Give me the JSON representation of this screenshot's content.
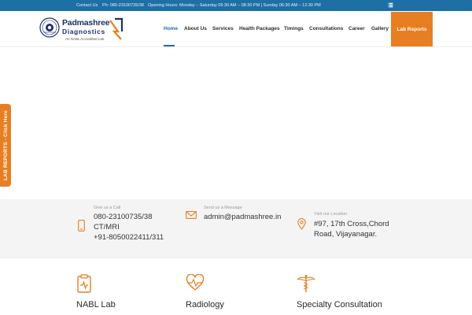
{
  "topbar": {
    "contact_label": "Contact Us",
    "phone": "Ph: 080-23100735/38",
    "hours": "Opening Hours: Monday – Saturday 06:30 AM – 08:30 PM | Sunday 06:30 AM – 12:30 PM"
  },
  "logo": {
    "brand_line1": "Padmashree",
    "brand_line2": "Diagnostics",
    "tagline": "An NABL Accredited Lab"
  },
  "nav": {
    "items": [
      {
        "label": "Home"
      },
      {
        "label": "About Us"
      },
      {
        "label": "Services"
      },
      {
        "label": "Health Packages"
      },
      {
        "label": "Timings"
      },
      {
        "label": "Consultations"
      },
      {
        "label": "Career"
      },
      {
        "label": "Gallery"
      }
    ],
    "lab_reports": "Lab Reports"
  },
  "side_tab": {
    "label": "LAB REPORTS - Click Here"
  },
  "contact": {
    "call": {
      "label": "Give us a Call",
      "lines": [
        "080-23100735/38",
        "CT/MRI",
        "+91-8050022411/311"
      ]
    },
    "message": {
      "label": "Send us a Message",
      "lines": [
        "admin@padmashree.in"
      ]
    },
    "location": {
      "label": "Visit our Location",
      "lines": [
        "#97, 17th Cross,Chord",
        "Road, Vijayanagar."
      ]
    }
  },
  "services": [
    {
      "title": "NABL Lab",
      "icon": "clipboard-icon"
    },
    {
      "title": "Radiology",
      "icon": "heartbeat-icon"
    },
    {
      "title": "Specialty Consultation",
      "icon": "caduceus-icon"
    }
  ],
  "colors": {
    "brand_blue": "#1d6fa5",
    "accent_orange": "#e77e22",
    "logo_navy": "#1f2f6b"
  }
}
